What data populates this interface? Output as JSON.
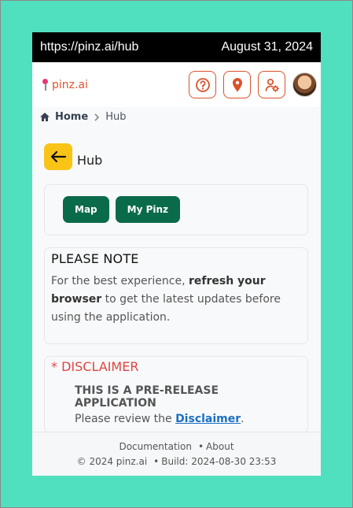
{
  "browser": {
    "url": "https://pinz.ai/hub",
    "date": "August 31, 2024"
  },
  "app": {
    "brand": "pinz.ai"
  },
  "header_icons": [
    "help-icon",
    "location-pin-icon",
    "user-settings-icon"
  ],
  "breadcrumb": {
    "home": "Home",
    "current": "Hub"
  },
  "page": {
    "title": "Hub"
  },
  "actions": {
    "map": "Map",
    "my_pinz": "My Pinz"
  },
  "note": {
    "title": "PLEASE NOTE",
    "text_before": "For the best experience,",
    "text_bold": "refresh your browser",
    "text_after": "to get the latest updates before using the application."
  },
  "disclaimer": {
    "title": "* DISCLAIMER",
    "heading": "THIS IS A PRE-RELEASE APPLICATION",
    "text_before": "Please review the",
    "link": "Disclaimer",
    "text_after": "."
  },
  "footer": {
    "documentation": "Documentation",
    "about": "About",
    "copyright": "© 2024 pinz.ai",
    "build": "Build: 2024-08-30 23:53"
  },
  "colors": {
    "accent": "#d9512c",
    "primary_button": "#0a6b4a",
    "back_button": "#f9c416",
    "disclaimer": "#e0453d",
    "link": "#1b6fc2",
    "backdrop": "#51e0bf"
  }
}
